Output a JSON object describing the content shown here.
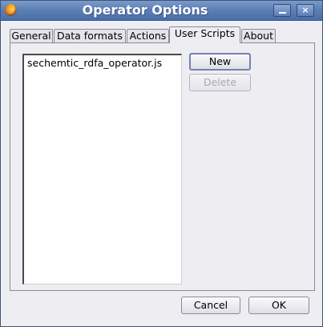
{
  "window": {
    "title": "Operator Options"
  },
  "title_buttons": {
    "maximize_glyph": "□",
    "close_glyph": "×"
  },
  "tabs": [
    {
      "label": "General",
      "active": false
    },
    {
      "label": "Data formats",
      "active": false
    },
    {
      "label": "Actions",
      "active": false
    },
    {
      "label": "User Scripts",
      "active": true
    },
    {
      "label": "About",
      "active": false
    }
  ],
  "user_scripts": {
    "items": [
      "sechemtic_rdfa_operator.js"
    ],
    "new_label": "New",
    "delete_label": "Delete"
  },
  "footer": {
    "cancel_label": "Cancel",
    "ok_label": "OK"
  },
  "colors": {
    "titlebar": "#5d80b6",
    "background": "#eeeef2",
    "default_button_border": "#7282b0"
  }
}
